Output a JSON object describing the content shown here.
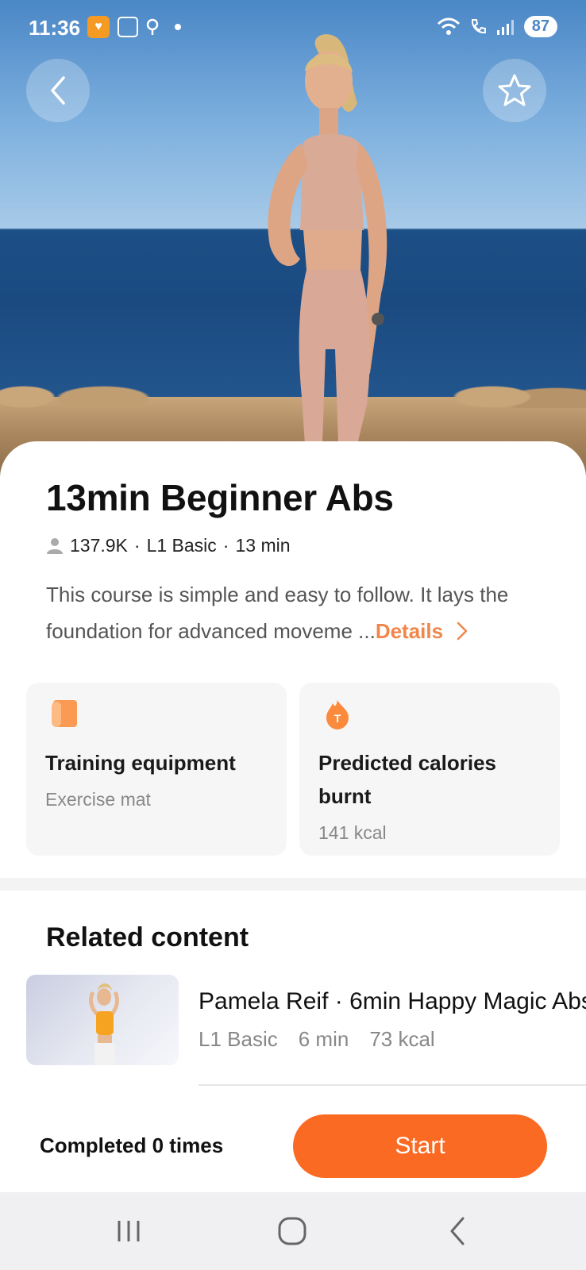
{
  "status_bar": {
    "time": "11:36",
    "battery": "87"
  },
  "hero": {
    "back_icon": "chevron-left-icon",
    "favorite_icon": "star-outline-icon"
  },
  "course": {
    "title": "13min Beginner Abs",
    "participants": "137.9K",
    "level": "L1 Basic",
    "duration": "13 min",
    "meta_separator": "·",
    "description": "This course is simple and easy to follow. It lays the foundation for advanced moveme ...",
    "details_label": "Details"
  },
  "info": {
    "equipment_label": "Training equipment",
    "equipment_value": "Exercise mat",
    "calories_label": "Predicted calories burnt",
    "calories_value": "141 kcal"
  },
  "related": {
    "section_title": "Related content",
    "items": [
      {
        "name": "Pamela Reif · 6min Happy Magic Abs",
        "level": "L1 Basic",
        "duration": "6 min",
        "calories": "73 kcal"
      }
    ]
  },
  "action": {
    "completed_text": "Completed 0 times",
    "start_label": "Start"
  },
  "colors": {
    "accent": "#fb6a22",
    "details_link": "#f0864a"
  }
}
